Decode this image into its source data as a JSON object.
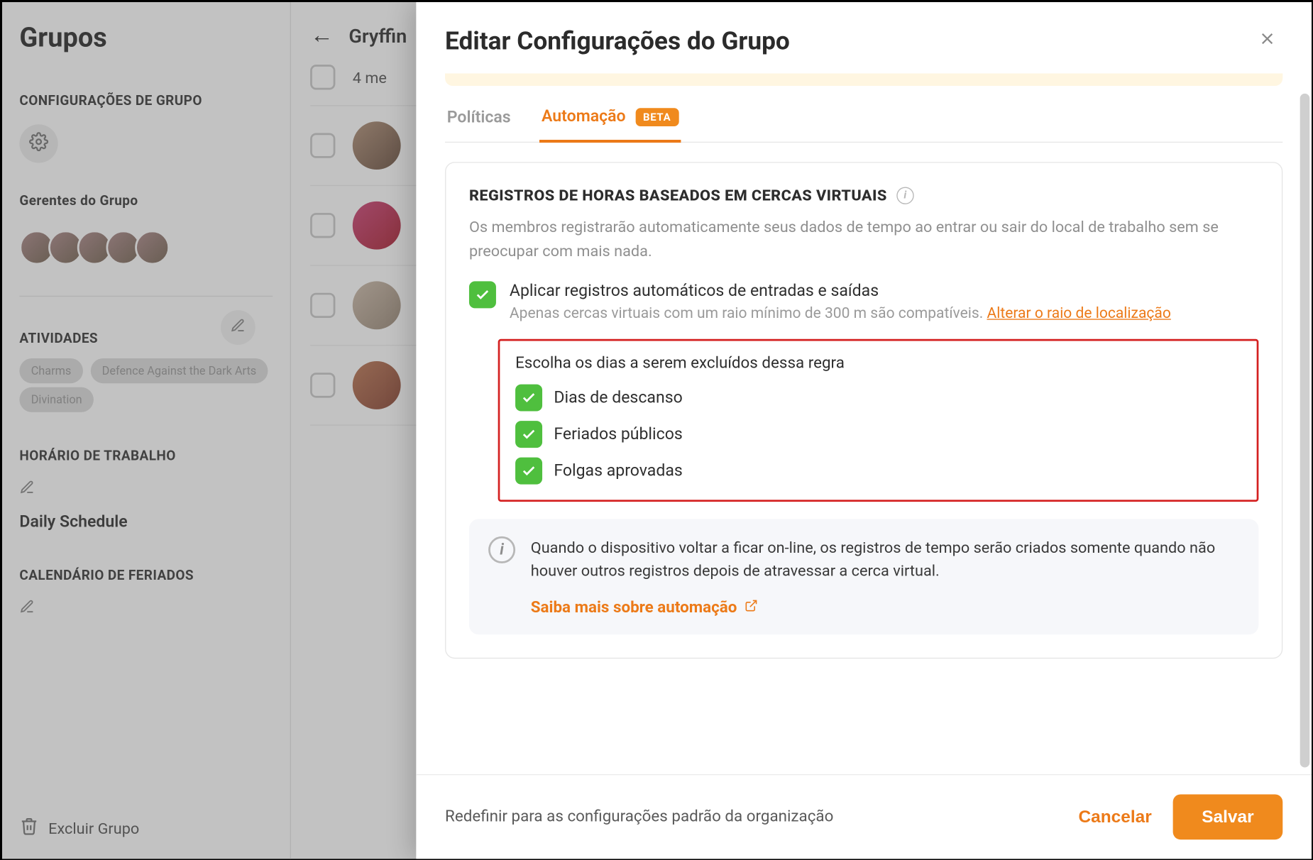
{
  "page": {
    "title": "Grupos"
  },
  "sidebar": {
    "section_config": "CONFIGURAÇÕES DE GRUPO",
    "section_managers": "Gerentes do Grupo",
    "section_activities": "ATIVIDADES",
    "activities": [
      "Charms",
      "Defence Against the Dark Arts",
      "Divination"
    ],
    "section_schedule": "HORÁRIO DE TRABALHO",
    "schedule_name": "Daily Schedule",
    "section_holiday": "CALENDÁRIO DE FERIADOS",
    "delete_label": "Excluir Grupo"
  },
  "main": {
    "group_name": "Gryffin",
    "members_summary": "4 me"
  },
  "modal": {
    "title": "Editar Configurações do Grupo",
    "tabs": {
      "policies": "Políticas",
      "automation": "Automação",
      "beta_badge": "BETA"
    },
    "card": {
      "title": "REGISTROS DE HORAS BASEADOS EM CERCAS VIRTUAIS",
      "description": "Os membros registrarão automaticamente seus dados de tempo ao entrar ou sair do local de trabalho sem se preocupar com mais nada.",
      "apply_label": "Aplicar registros automáticos de entradas e saídas",
      "apply_sub": "Apenas cercas virtuais com um raio mínimo de 300 m são compatíveis. ",
      "change_radius_link": "Alterar o raio de localização",
      "exclude_title": "Escolha os dias a serem excluídos dessa regra",
      "exclude_options": [
        "Dias de descanso",
        "Feriados públicos",
        "Folgas aprovadas"
      ],
      "note": "Quando o dispositivo voltar a ficar on-line, os registros de tempo serão criados somente quando não houver outros registros depois de atravessar a cerca virtual.",
      "learn_more": "Saiba mais sobre automação"
    },
    "footer": {
      "reset": "Redefinir para as configurações padrão da organização",
      "cancel": "Cancelar",
      "save": "Salvar"
    }
  }
}
